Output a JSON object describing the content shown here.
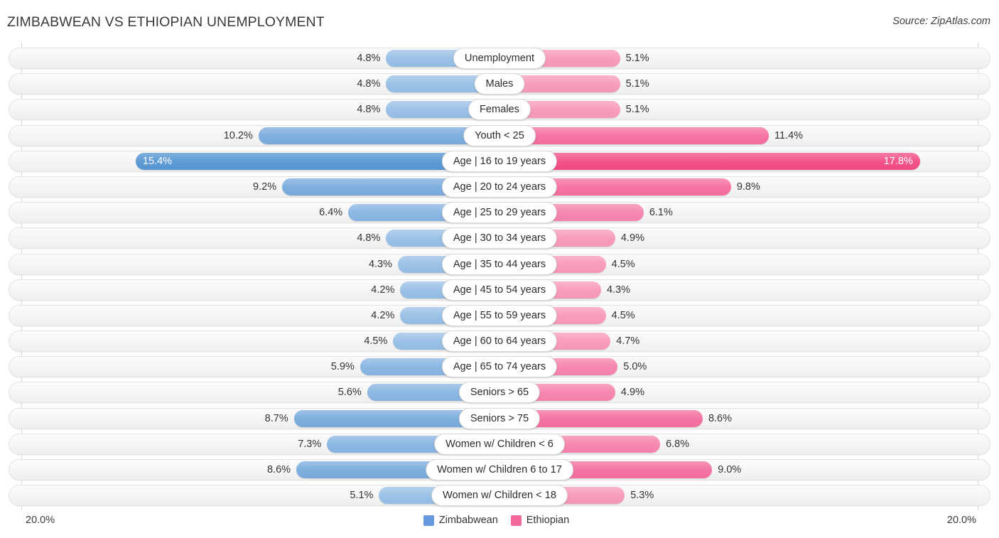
{
  "header": {
    "title": "ZIMBABWEAN VS ETHIOPIAN UNEMPLOYMENT",
    "source": "Source: ZipAtlas.com"
  },
  "footer": {
    "axis_left": "20.0%",
    "axis_right": "20.0%",
    "legend": [
      {
        "label": "Zimbabwean",
        "color": "#6699dd"
      },
      {
        "label": "Ethiopian",
        "color": "#f4689b"
      }
    ]
  },
  "chart_data": {
    "type": "bar",
    "title": "ZIMBABWEAN VS ETHIOPIAN UNEMPLOYMENT",
    "subtitle": "Source: ZipAtlas.com",
    "orientation": "horizontal-diverging",
    "xlabel": "",
    "ylabel": "",
    "xlim": [
      0,
      20
    ],
    "axis_left_max": "20.0%",
    "axis_right_max": "20.0%",
    "grid": false,
    "legend_position": "bottom-center",
    "unit": "%",
    "categories": [
      "Unemployment",
      "Males",
      "Females",
      "Youth < 25",
      "Age | 16 to 19 years",
      "Age | 20 to 24 years",
      "Age | 25 to 29 years",
      "Age | 30 to 34 years",
      "Age | 35 to 44 years",
      "Age | 45 to 54 years",
      "Age | 55 to 59 years",
      "Age | 60 to 64 years",
      "Age | 65 to 74 years",
      "Seniors > 65",
      "Seniors > 75",
      "Women w/ Children < 6",
      "Women w/ Children 6 to 17",
      "Women w/ Children < 18"
    ],
    "series": [
      {
        "name": "Zimbabwean",
        "color": "#6699dd",
        "values": [
          4.8,
          4.8,
          4.8,
          10.2,
          15.4,
          9.2,
          6.4,
          4.8,
          4.3,
          4.2,
          4.2,
          4.5,
          5.9,
          5.6,
          8.7,
          7.3,
          8.6,
          5.1
        ]
      },
      {
        "name": "Ethiopian",
        "color": "#f4689b",
        "values": [
          5.1,
          5.1,
          5.1,
          11.4,
          17.8,
          9.8,
          6.1,
          4.9,
          4.5,
          4.3,
          4.5,
          4.7,
          5.0,
          4.9,
          8.6,
          6.8,
          9.0,
          5.3
        ]
      }
    ]
  },
  "rows": [
    {
      "label": "Unemployment",
      "left": "4.8%",
      "right": "5.1%",
      "lv": 4.8,
      "rv": 5.1,
      "mag": "m1"
    },
    {
      "label": "Males",
      "left": "4.8%",
      "right": "5.1%",
      "lv": 4.8,
      "rv": 5.1,
      "mag": "m1"
    },
    {
      "label": "Females",
      "left": "4.8%",
      "right": "5.1%",
      "lv": 4.8,
      "rv": 5.1,
      "mag": "m1"
    },
    {
      "label": "Youth < 25",
      "left": "10.2%",
      "right": "11.4%",
      "lv": 10.2,
      "rv": 11.4,
      "mag": "m3"
    },
    {
      "label": "Age | 16 to 19 years",
      "left": "15.4%",
      "right": "17.8%",
      "lv": 15.4,
      "rv": 17.8,
      "mag": "hl"
    },
    {
      "label": "Age | 20 to 24 years",
      "left": "9.2%",
      "right": "9.8%",
      "lv": 9.2,
      "rv": 9.8,
      "mag": "m3"
    },
    {
      "label": "Age | 25 to 29 years",
      "left": "6.4%",
      "right": "6.1%",
      "lv": 6.4,
      "rv": 6.1,
      "mag": "m2"
    },
    {
      "label": "Age | 30 to 34 years",
      "left": "4.8%",
      "right": "4.9%",
      "lv": 4.8,
      "rv": 4.9,
      "mag": "m1"
    },
    {
      "label": "Age | 35 to 44 years",
      "left": "4.3%",
      "right": "4.5%",
      "lv": 4.3,
      "rv": 4.5,
      "mag": "m1"
    },
    {
      "label": "Age | 45 to 54 years",
      "left": "4.2%",
      "right": "4.3%",
      "lv": 4.2,
      "rv": 4.3,
      "mag": "m1"
    },
    {
      "label": "Age | 55 to 59 years",
      "left": "4.2%",
      "right": "4.5%",
      "lv": 4.2,
      "rv": 4.5,
      "mag": "m1"
    },
    {
      "label": "Age | 60 to 64 years",
      "left": "4.5%",
      "right": "4.7%",
      "lv": 4.5,
      "rv": 4.7,
      "mag": "m1"
    },
    {
      "label": "Age | 65 to 74 years",
      "left": "5.9%",
      "right": "5.0%",
      "lv": 5.9,
      "rv": 5.0,
      "mag": "m2"
    },
    {
      "label": "Seniors > 65",
      "left": "5.6%",
      "right": "4.9%",
      "lv": 5.6,
      "rv": 4.9,
      "mag": "m2"
    },
    {
      "label": "Seniors > 75",
      "left": "8.7%",
      "right": "8.6%",
      "lv": 8.7,
      "rv": 8.6,
      "mag": "m3"
    },
    {
      "label": "Women w/ Children < 6",
      "left": "7.3%",
      "right": "6.8%",
      "lv": 7.3,
      "rv": 6.8,
      "mag": "m2"
    },
    {
      "label": "Women w/ Children 6 to 17",
      "left": "8.6%",
      "right": "9.0%",
      "lv": 8.6,
      "rv": 9.0,
      "mag": "m3"
    },
    {
      "label": "Women w/ Children < 18",
      "left": "5.1%",
      "right": "5.3%",
      "lv": 5.1,
      "rv": 5.3,
      "mag": "m1"
    }
  ]
}
